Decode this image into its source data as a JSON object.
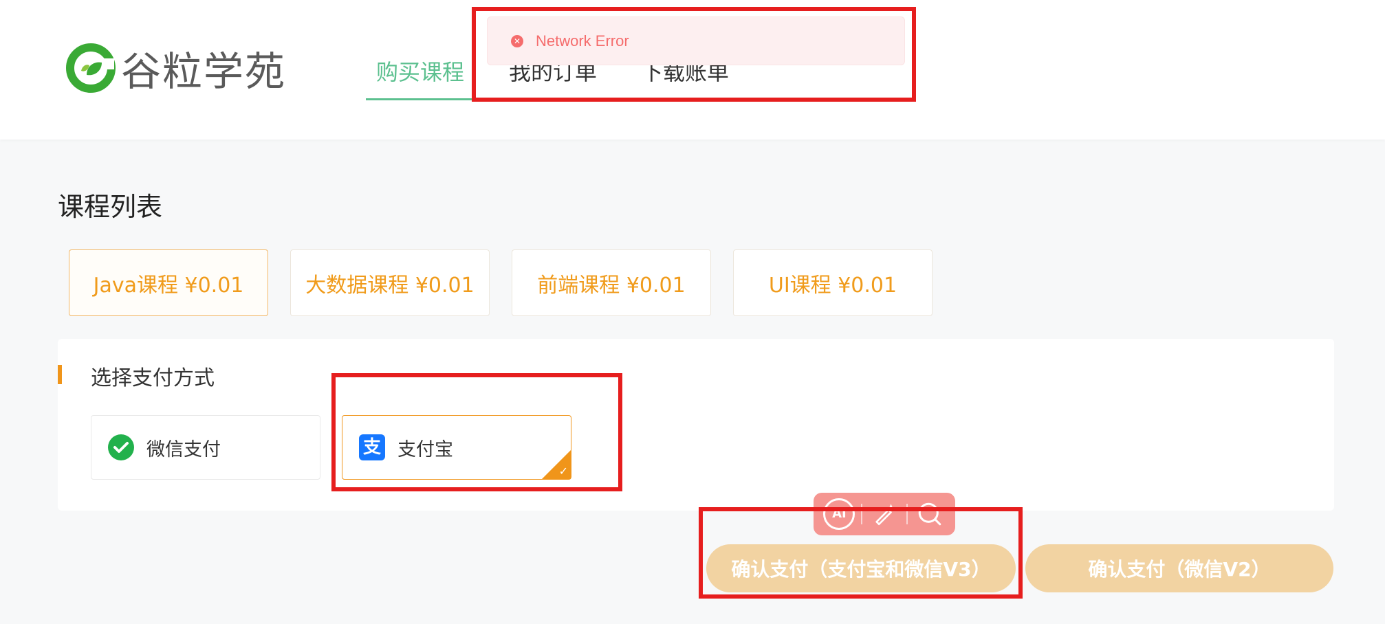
{
  "header": {
    "logo_text": "谷粒学苑",
    "nav": [
      {
        "label": "购买课程",
        "active": true
      },
      {
        "label": "我的订单",
        "active": false
      },
      {
        "label": "下载账单",
        "active": false
      }
    ]
  },
  "toast": {
    "message": "Network Error",
    "icon": "error-circle-icon",
    "color": "#f56c6c"
  },
  "courses": {
    "title": "课程列表",
    "items": [
      {
        "label": "Java课程 ¥0.01",
        "selected": true
      },
      {
        "label": "大数据课程 ¥0.01",
        "selected": false
      },
      {
        "label": "前端课程 ¥0.01",
        "selected": false
      },
      {
        "label": "UI课程 ¥0.01",
        "selected": false
      }
    ]
  },
  "payment": {
    "title": "选择支付方式",
    "options": [
      {
        "label": "微信支付",
        "icon": "wechat-pay-icon",
        "selected": false
      },
      {
        "label": "支付宝",
        "icon": "alipay-icon",
        "alipay_glyph": "支",
        "selected": true
      }
    ],
    "check_mark": "✓"
  },
  "mini_toolbar": {
    "ai_label": "AI",
    "magic_icon": "magic-pen-icon",
    "search_icon": "search-icon"
  },
  "actions": {
    "confirm_v3": "确认支付（支付宝和微信V3）",
    "confirm_v2": "确认支付（微信V2）"
  },
  "colors": {
    "accent_green": "#5cc08f",
    "accent_orange": "#f0951a",
    "annotation_red": "#e61e1e",
    "button_disabled": "#f2d3a2"
  }
}
